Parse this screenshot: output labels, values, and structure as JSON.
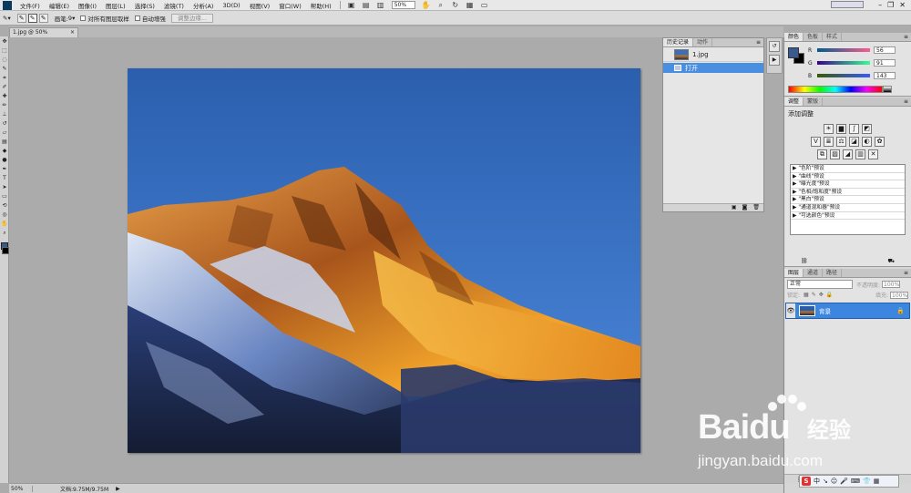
{
  "menubar": {
    "items": [
      "文件(F)",
      "编辑(E)",
      "图像(I)",
      "图层(L)",
      "选择(S)",
      "滤镜(T)",
      "分析(A)",
      "3D(D)",
      "视图(V)",
      "窗口(W)",
      "帮助(H)"
    ],
    "zoom": "50%"
  },
  "options": {
    "brush_size": "9",
    "sample_all_layers": "对所有图层取样",
    "auto_enhance": "自动增强",
    "refine_edge": "调整边缘..."
  },
  "document": {
    "tab_title": "1.jpg @ 50%(RGB/8#)",
    "close": "×"
  },
  "status": {
    "zoom": "50%",
    "doc_size": "文档:9.75M/9.75M"
  },
  "history": {
    "tabs": [
      "历史记录",
      "动作"
    ],
    "snapshot_name": "1.jpg",
    "steps": [
      "打开"
    ]
  },
  "color": {
    "tabs": [
      "颜色",
      "色板",
      "样式"
    ],
    "r": "56",
    "g": "91",
    "b": "143",
    "r_label": "R",
    "g_label": "G",
    "b_label": "B",
    "foreground_hex": "#385b8f"
  },
  "adjustments": {
    "tabs": [
      "调整",
      "蒙版"
    ],
    "title": "添加调整",
    "presets": [
      "\"色阶\"预设",
      "\"曲线\"预设",
      "\"曝光度\"预设",
      "\"色相/饱和度\"预设",
      "\"黑白\"预设",
      "\"通道混和器\"预设",
      "\"可选颜色\"预设"
    ]
  },
  "layers": {
    "tabs": [
      "图层",
      "通道",
      "路径"
    ],
    "blend_mode": "正常",
    "opacity_label": "不透明度:",
    "opacity": "100%",
    "lock_label": "锁定:",
    "fill_label": "填充:",
    "fill": "100%",
    "layer_name": "背景"
  },
  "watermark": {
    "brand": "Baidu",
    "brand_cn": "经验",
    "url": "jingyan.baidu.com"
  },
  "ime": {
    "logo": "S",
    "mode": "中"
  }
}
